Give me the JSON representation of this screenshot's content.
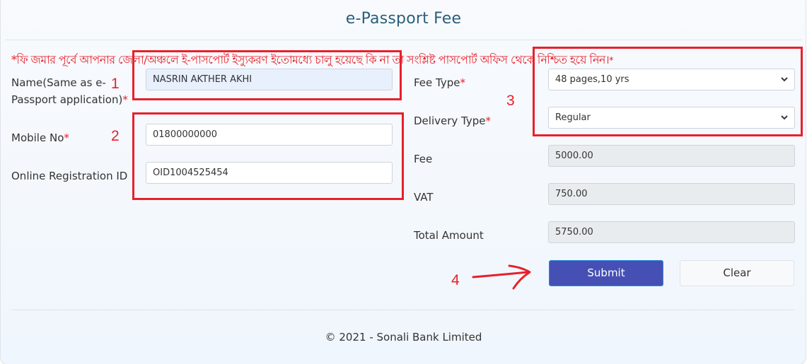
{
  "page": {
    "title": "e-Passport Fee",
    "notice": "*ফি জমার পূর্বে আপনার জেলা/অঞ্চলে ই-পাসপোর্ট ইস্যুকরণ ইতোমধ্যে চালু হয়েছে কি না তা সংশ্লিষ্ট পাসপোর্ট অফিস থেকে নিশ্চিত হয়ে নিন।",
    "notice_star": "*"
  },
  "form": {
    "name": {
      "label_line1": "Name(Same as e-",
      "label_line2": "Passport application)",
      "required": "*",
      "value": "NASRIN AKTHER AKHI"
    },
    "mobile": {
      "label": "Mobile No",
      "required": "*",
      "value": "01800000000"
    },
    "registration": {
      "label": "Online Registration ID",
      "value": "OID1004525454"
    },
    "fee_type": {
      "label": "Fee Type",
      "required": "*",
      "selected": "48 pages,10 yrs"
    },
    "delivery_type": {
      "label": "Delivery Type",
      "required": "*",
      "selected": "Regular"
    },
    "fee": {
      "label": "Fee",
      "value": "5000.00"
    },
    "vat": {
      "label": "VAT",
      "value": "750.00"
    },
    "total": {
      "label": "Total Amount",
      "value": "5750.00"
    }
  },
  "buttons": {
    "submit": "Submit",
    "clear": "Clear"
  },
  "footer": {
    "text": "© 2021 - Sonali Bank Limited"
  },
  "annotations": {
    "n1": "1",
    "n2": "2",
    "n3": "3",
    "n4": "4",
    "color": "#e8202a"
  },
  "colors": {
    "title": "#2b5f7a",
    "submit_bg": "#4650b4",
    "required": "#e8202a"
  }
}
